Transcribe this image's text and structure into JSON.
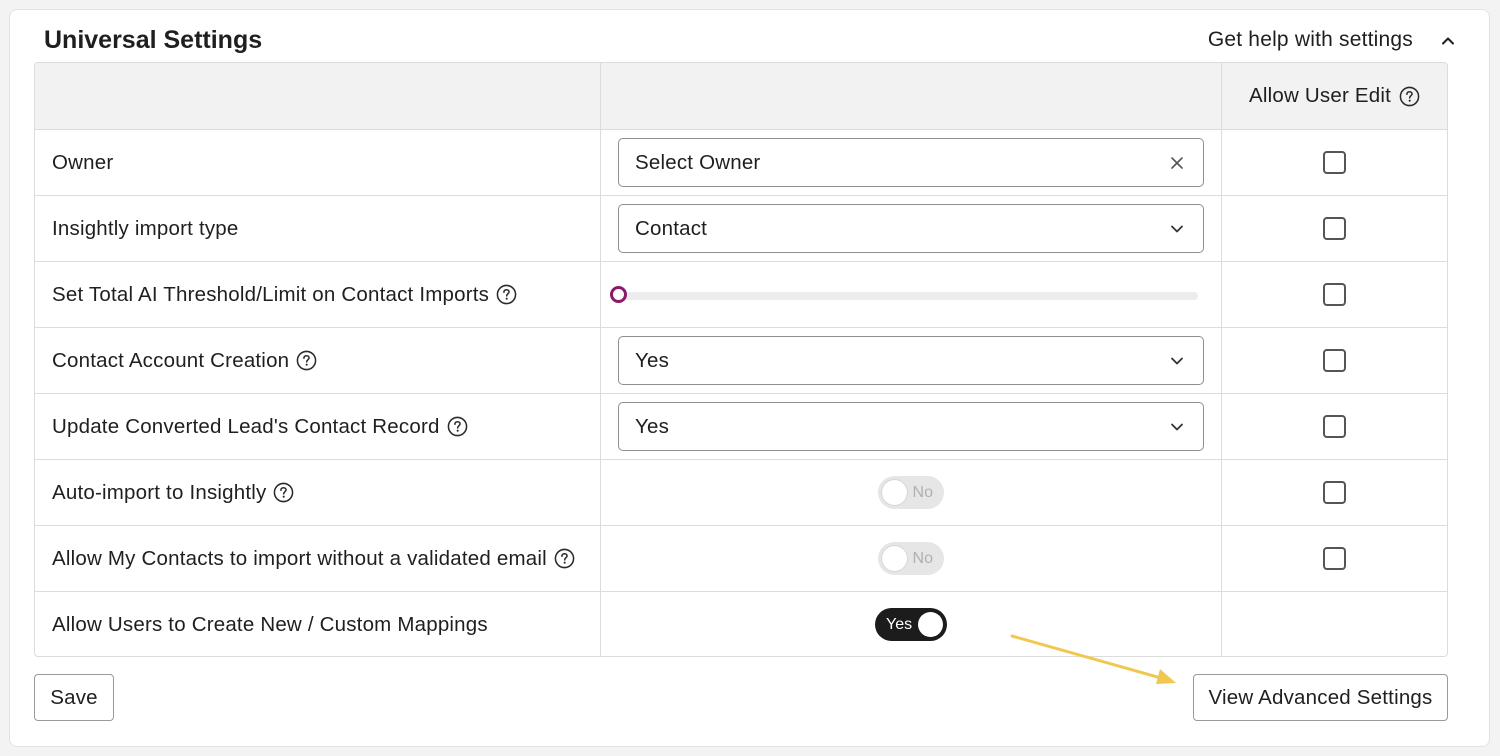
{
  "header": {
    "title": "Universal Settings",
    "help_link": "Get help with settings"
  },
  "table": {
    "header_allow_edit": "Allow User Edit",
    "rows": [
      {
        "label": "Owner",
        "control": "select",
        "value": "Select Owner",
        "allow_edit": false
      },
      {
        "label": "Insightly import type",
        "control": "select",
        "value": "Contact",
        "allow_edit": false
      },
      {
        "label": "Set Total AI Threshold/Limit on Contact Imports",
        "control": "slider",
        "value": 0,
        "allow_edit": false
      },
      {
        "label": "Contact Account Creation",
        "control": "select",
        "value": "Yes",
        "allow_edit": false
      },
      {
        "label": "Update Converted Lead's Contact Record",
        "control": "select",
        "value": "Yes",
        "allow_edit": false
      },
      {
        "label": "Auto-import to Insightly",
        "control": "toggle",
        "value": "No",
        "allow_edit": false
      },
      {
        "label": "Allow My Contacts to import without a validated email",
        "control": "toggle",
        "value": "No",
        "allow_edit": false
      },
      {
        "label": "Allow Users to Create New / Custom Mappings",
        "control": "toggle",
        "value": "Yes"
      }
    ]
  },
  "actions": {
    "save_label": "Save",
    "advanced_label": "View Advanced Settings"
  },
  "colors": {
    "slider_thumb": "#8b1a6b",
    "toggle_on": "#1c1c1c",
    "toggle_off": "#e6e6e6",
    "annotation_arrow": "#f0c850"
  }
}
